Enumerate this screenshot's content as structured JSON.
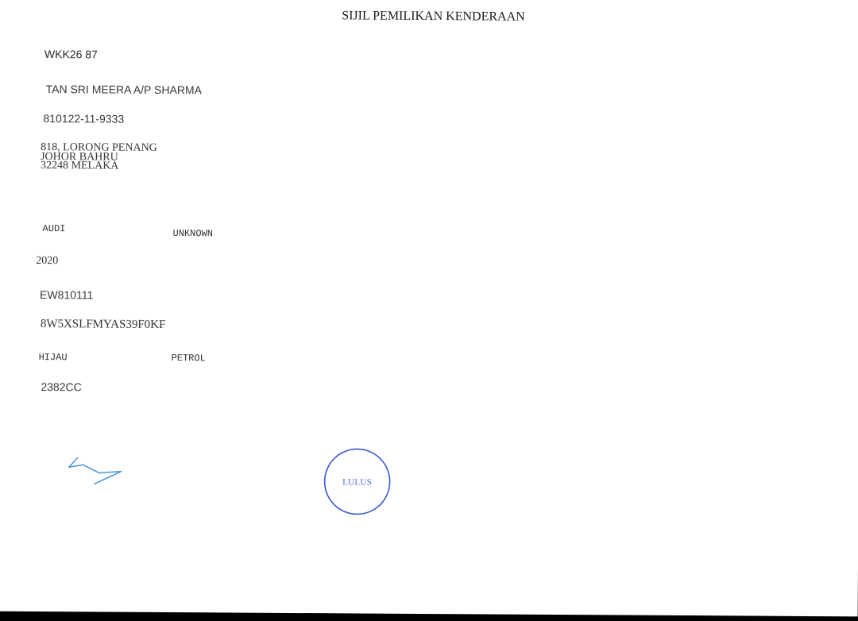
{
  "document": {
    "title": "SIJIL PEMILIKAN KENDERAAN",
    "registration_number": "WKK26 87",
    "owner_name": "TAN SRI MEERA A/P SHARMA",
    "ic_number": "810122-11-9333",
    "address": [
      "818, LORONG PENANG",
      "JOHOR BAHRU",
      "32248 MELAKA"
    ],
    "make": "AUDI",
    "model": "UNKNOWN",
    "year": "2020",
    "engine_number": "EW810111",
    "chassis_number": "8W5XSLFMYAS39F0KF",
    "colour": "HIJAU",
    "fuel": "PETROL",
    "engine_capacity": "2382CC"
  },
  "stamp": {
    "text": "LULUS",
    "color": "#3a57d6"
  },
  "signature": {
    "color": "#3b8fd6"
  },
  "colors": {
    "paper": "#ffffff",
    "background": "#000000",
    "text": "#333333"
  }
}
